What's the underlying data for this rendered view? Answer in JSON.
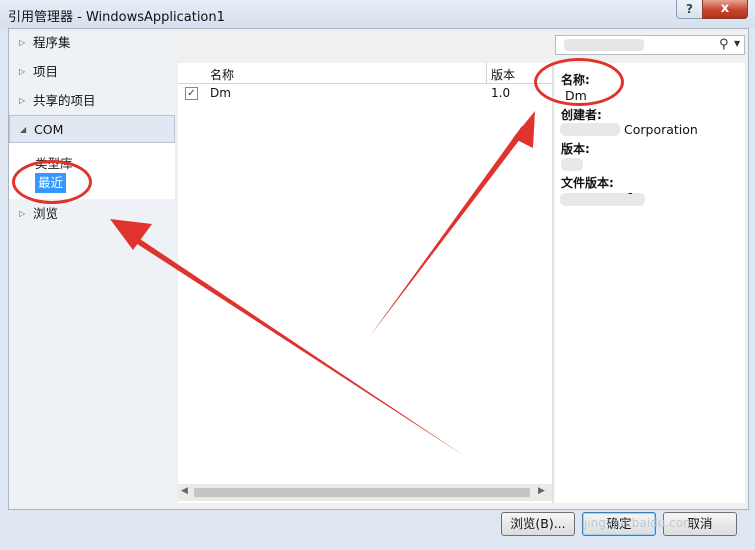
{
  "window": {
    "title": "引用管理器 - WindowsApplication1",
    "help": "?",
    "close": "x"
  },
  "nav": {
    "items": [
      {
        "label": "程序集"
      },
      {
        "label": "项目"
      },
      {
        "label": "共享的项目"
      },
      {
        "label": "COM"
      },
      {
        "label": "浏览"
      }
    ],
    "com_children": [
      {
        "label": "类型库"
      },
      {
        "label": "最近"
      }
    ]
  },
  "list": {
    "columns": [
      "名称",
      "版本"
    ],
    "rows": [
      {
        "checked": true,
        "name": "Dm",
        "version": "1.0"
      }
    ]
  },
  "search": {
    "value": "",
    "icon": "search-icon"
  },
  "details": {
    "name_label": "名称:",
    "name_value": "Dm",
    "creator_label": "创建者:",
    "creator_value": "Corporation",
    "version_label": "版本:",
    "file_version_label": "文件版本:",
    "file_version_value": "-"
  },
  "buttons": {
    "browse": "浏览(B)...",
    "ok": "确定",
    "cancel": "取消"
  },
  "watermark": "jingyan.baidu.com",
  "colors": {
    "annotation": "#e0332e",
    "selection": "#3399ff"
  }
}
